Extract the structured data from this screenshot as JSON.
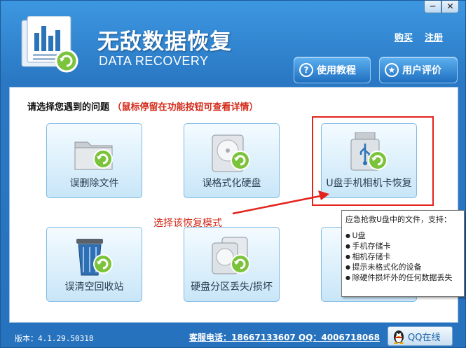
{
  "window": {
    "minimize_glyph": "─",
    "close_glyph": "✕"
  },
  "header": {
    "title": "无敌数据恢复",
    "subtitle": "DATA RECOVERY",
    "link_buy": "购买",
    "link_register": "注册",
    "btn_tutorial": "使用教程",
    "btn_review": "用户评价",
    "tutorial_icon": "question-icon",
    "review_icon": "thumbs-up-icon"
  },
  "main": {
    "prompt": "请选择您遇到的问题",
    "hint": "（鼠标停留在功能按钮可查看详情）",
    "tiles": [
      {
        "label": "误删除文件",
        "icon": "folder-recover-icon"
      },
      {
        "label": "误格式化硬盘",
        "icon": "disk-recover-icon"
      },
      {
        "label": "U盘手机相机卡恢复",
        "icon": "usb-recover-icon"
      },
      {
        "label": "误清空回收站",
        "icon": "recycle-bin-recover-icon"
      },
      {
        "label": "硬盘分区丢失/损坏",
        "icon": "partition-recover-icon"
      },
      {
        "label": "",
        "icon": ""
      }
    ],
    "annotation": "选择该恢复模式"
  },
  "tooltip": {
    "head": "应急抢救U盘中的文件，支持：",
    "items": [
      "U盘",
      "手机存储卡",
      "相机存储卡",
      "提示未格式化的设备",
      "除硬件损坏外的任何数据丢失"
    ]
  },
  "status": {
    "version": "版本：4.1.29.50318",
    "contact": "客服电话：18667133607 QQ：4006718068",
    "qq_button": "QQ在线"
  },
  "colors": {
    "accent": "#2a78c4",
    "annotation_red": "#e3231c",
    "tile_border": "#7fbbe3"
  }
}
